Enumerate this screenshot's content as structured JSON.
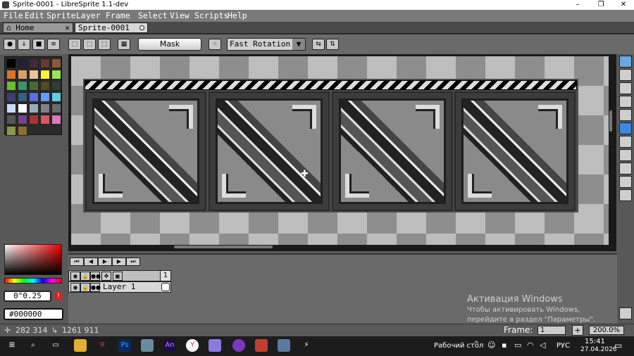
{
  "window": {
    "title": "Sprite-0001 - LibreSprite 1.1-dev",
    "minimize": "–",
    "maximize": "❐",
    "close": "✕"
  },
  "menu": [
    "File",
    "Edit",
    "Sprite",
    "Layer",
    "Frame",
    "Select",
    "View",
    "Scripts",
    "Help"
  ],
  "tabs": {
    "home": "Home",
    "home_close": "✕",
    "sprite": "Sprite-0001"
  },
  "toolbar": {
    "mask_label": "Mask",
    "rotation_algorithm": "Fast Rotation"
  },
  "colors": {
    "accent": "#4a90d9",
    "warning": "#e02020"
  },
  "palette": [
    "#000000",
    "#222034",
    "#45283c",
    "#663931",
    "#8f563b",
    "#df7126",
    "#d9a066",
    "#eec39a",
    "#fbf236",
    "#99e550",
    "#6abe30",
    "#37946e",
    "#4b692f",
    "#524b24",
    "#323c39",
    "#3f3f74",
    "#306082",
    "#5b6ee1",
    "#639bff",
    "#5fcde4",
    "#cbdbfc",
    "#ffffff",
    "#9badb7",
    "#847e87",
    "#696a6a",
    "#595652",
    "#76428a",
    "#ac3232",
    "#d95763",
    "#d77bba",
    "#8f974a",
    "#8a6f30"
  ],
  "color_panel": {
    "opacity": "0°0.25",
    "hex": "#000000",
    "warn": "!"
  },
  "timeline": {
    "layer_name": "Layer 1",
    "frame_number": "1"
  },
  "watermark": {
    "title": "Активация Windows",
    "body": "Чтобы активировать Windows, перейдите в раздел \"Параметры\"."
  },
  "status": {
    "cursor_pos": "282 314",
    "selection_size": "1261 911",
    "frame_label": "Frame:",
    "frame_value": "1",
    "add_frame": "+",
    "zoom": "200.0%"
  },
  "taskbar": {
    "desktop_label": "Рабочий стол",
    "lang": "РУС",
    "time": "15:41",
    "date": "27.04.2026"
  }
}
